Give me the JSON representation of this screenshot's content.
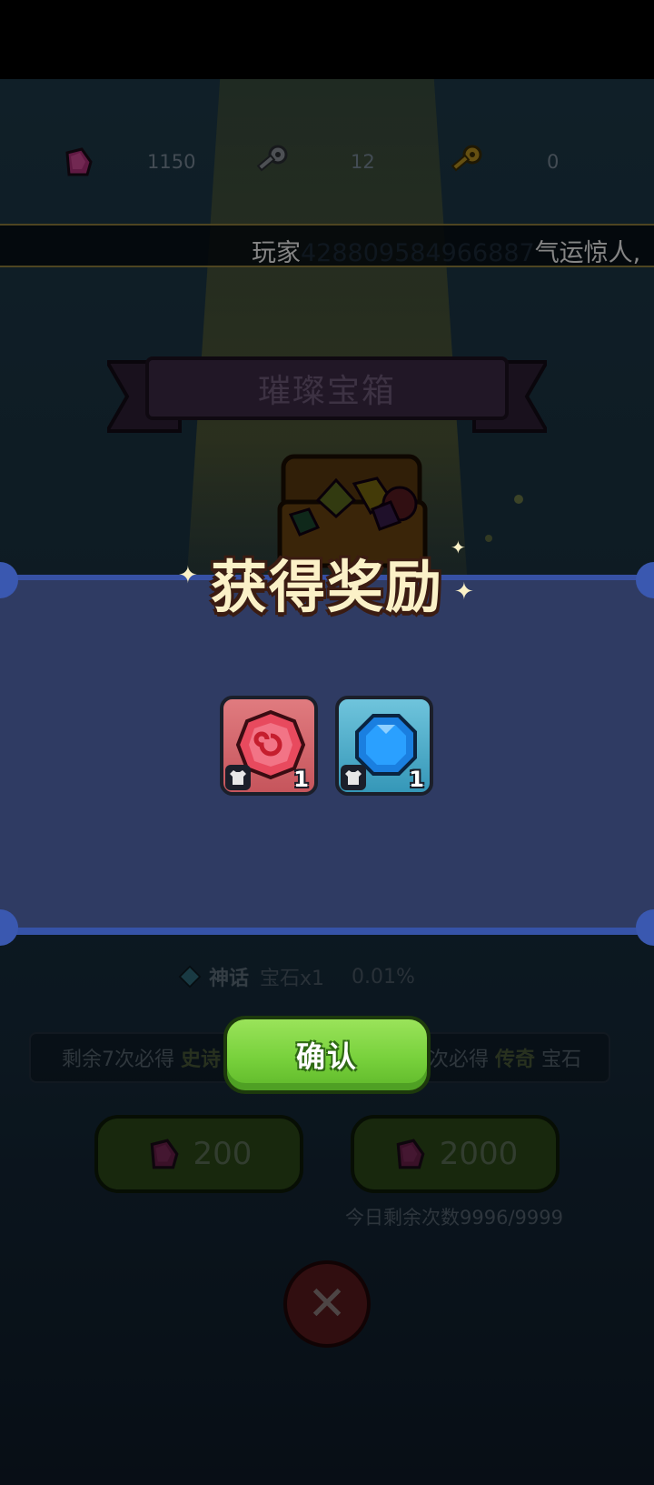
{
  "currencies": [
    {
      "icon": "purple-gem-icon",
      "value": "1150"
    },
    {
      "icon": "silver-key-icon",
      "value": "12"
    },
    {
      "icon": "gold-key-icon",
      "value": "0"
    }
  ],
  "ticker": {
    "prefix": "玩家",
    "player_id": "428809584966887",
    "suffix": "气运惊人,"
  },
  "chest": {
    "title": "璀璨宝箱"
  },
  "reward": {
    "title": "获得奖励",
    "items": [
      {
        "icon": "red-spiral-gem-icon",
        "badge": "equipment-badge-icon",
        "count": "1"
      },
      {
        "icon": "blue-gem-icon",
        "badge": "equipment-badge-icon",
        "count": "1"
      }
    ],
    "confirm_label": "确认"
  },
  "rates": [
    {
      "tier": "神话",
      "item": "宝石x1",
      "pct": "0.01%"
    }
  ],
  "pity": {
    "left_prefix": "剩余7次必得",
    "left_tier": "史诗",
    "right_prefix": "次必得",
    "right_tier": "传奇",
    "right_suffix": "宝石"
  },
  "draw_buttons": [
    {
      "icon": "purple-gem-icon",
      "cost": "200"
    },
    {
      "icon": "purple-gem-icon",
      "cost": "2000"
    }
  ],
  "remaining_text": "今日剩余次数9996/9999",
  "colors": {
    "panel": "#2f3b63",
    "panel_border": "#3751a4",
    "confirm": "#78d13c",
    "title_text": "#fbf1c7"
  }
}
